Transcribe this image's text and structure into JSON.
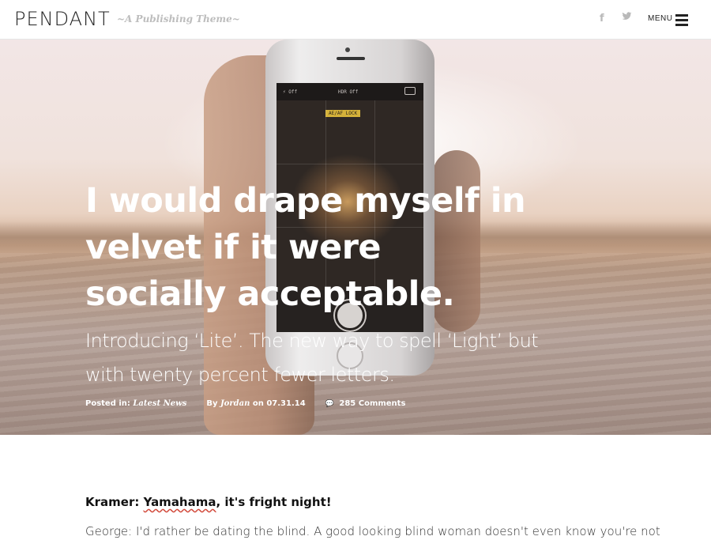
{
  "header": {
    "logo": "PENDANT",
    "tagline": "~A Publishing Theme~",
    "social": [
      {
        "icon": "facebook-icon",
        "glyph": "f"
      },
      {
        "icon": "twitter-icon"
      }
    ],
    "menu_label": "MENU",
    "menu_icon": "hamburger-icon"
  },
  "hero": {
    "phone_screen": {
      "flash": "⚡ Off",
      "hdr": "HDR Off",
      "ae_lock": "AE/AF LOCK"
    },
    "title": "I would drape myself in velvet if it were socially acceptable.",
    "subtitle": "Introducing ‘Lite’. The new way to spell ‘Light’ but with twenty percent fewer letters.",
    "meta": {
      "posted_in_label": "Posted in:",
      "category": "Latest News",
      "by_label": "By",
      "author": "Jordan",
      "on_label": "on",
      "date": "07.31.14",
      "comments": "285 Comments",
      "comments_icon": "speech-bubble-icon"
    }
  },
  "article": {
    "lede_prefix": "Kramer: ",
    "lede_link": "Yamahama",
    "lede_suffix": ", it's fright night!",
    "paragraph": "George: I'd rather be dating the blind. A good looking blind woman doesn't even know you're not"
  },
  "colors": {
    "accent_underline": "#d24a3c",
    "header_text": "#222222",
    "muted": "#bdbdbd"
  }
}
